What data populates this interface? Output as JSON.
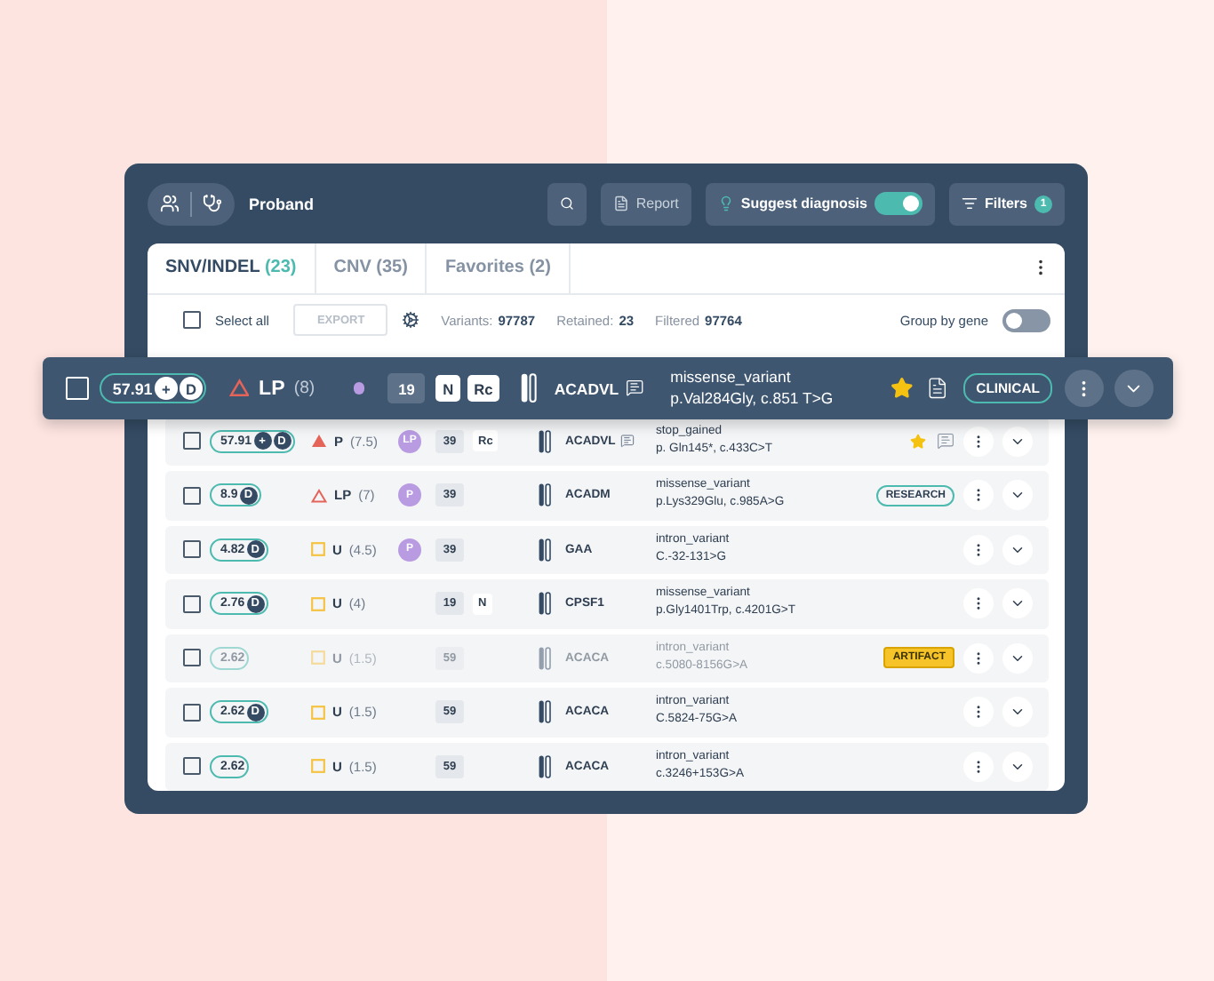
{
  "header": {
    "label": "Proband",
    "report_button": "Report",
    "suggest": {
      "label": "Suggest diagnosis",
      "on": true
    },
    "filters": {
      "label": "Filters",
      "count": "1"
    }
  },
  "tabs": [
    {
      "label": "SNV/INDEL",
      "count": "(23)",
      "selected": true
    },
    {
      "label": "CNV",
      "count": "(35)",
      "selected": false
    },
    {
      "label": "Favorites",
      "count": "(2)",
      "selected": false
    }
  ],
  "toolbar": {
    "select_all": {
      "label": "Select all",
      "checked": false
    },
    "export": {
      "label": "EXPORT",
      "disabled": true
    },
    "stats": [
      {
        "label": "Variants:",
        "value": "97787"
      },
      {
        "label": "Retained:",
        "value": "23"
      },
      {
        "label": "Filtered",
        "value": "97764"
      }
    ],
    "group_by_gene": {
      "label": "Group by gene",
      "on": false
    }
  },
  "highlighted_row": {
    "checked": false,
    "dimmed": false,
    "score": "57.91",
    "plus": "+",
    "d": "D",
    "classification": {
      "kind": "triangle-outline",
      "label": "LP",
      "score": "(8)"
    },
    "acmg": {
      "kind": "dot"
    },
    "chrom": "19",
    "tags": [
      "N",
      "Rc"
    ],
    "gene": "ACADVL",
    "comment": true,
    "consequence": "missense_variant",
    "hgvs": "p.Val284Gly, c.851 T>G",
    "starred": true,
    "comment_note": false,
    "report": true,
    "tag": {
      "kind": "clinical",
      "label": "CLINICAL"
    }
  },
  "rows": [
    {
      "checked": false,
      "dimmed": false,
      "score": "57.91",
      "plus": "+",
      "d": "D",
      "classification": {
        "kind": "triangle-filled",
        "label": "P",
        "score": "(7.5)"
      },
      "acmg": {
        "kind": "badge",
        "label": "LP"
      },
      "chrom": "39",
      "tags": [
        "Rc"
      ],
      "gene": "ACADVL",
      "comment": true,
      "consequence": "stop_gained",
      "hgvs": "p. Gln145*, c.433C>T",
      "starred": true,
      "comment_note": true,
      "report": false
    },
    {
      "checked": false,
      "dimmed": false,
      "score": "8.9",
      "d": "D",
      "classification": {
        "kind": "triangle-outline",
        "label": "LP",
        "score": "(7)"
      },
      "acmg": {
        "kind": "badge",
        "label": "P"
      },
      "chrom": "39",
      "tags": [],
      "gene": "ACADM",
      "comment": false,
      "consequence": "missense_variant",
      "hgvs": "p.Lys329Glu, c.985A>G",
      "starred": false,
      "comment_note": false,
      "report": false,
      "tag": {
        "kind": "research",
        "label": "RESEARCH"
      }
    },
    {
      "checked": false,
      "dimmed": false,
      "score": "4.82",
      "d": "D",
      "classification": {
        "kind": "square",
        "label": "U",
        "score": "(4.5)"
      },
      "acmg": {
        "kind": "badge",
        "label": "P"
      },
      "chrom": "39",
      "tags": [],
      "gene": "GAA",
      "comment": false,
      "consequence": "intron_variant",
      "hgvs": "C.-32-131>G",
      "starred": false,
      "comment_note": false,
      "report": false
    },
    {
      "checked": false,
      "dimmed": false,
      "score": "2.76",
      "d": "D",
      "classification": {
        "kind": "square",
        "label": "U",
        "score": "(4)"
      },
      "chrom": "19",
      "tags": [
        "N"
      ],
      "gene": "CPSF1",
      "comment": false,
      "consequence": "missense_variant",
      "hgvs": "p.Gly1401Trp, c.4201G>T",
      "starred": false,
      "comment_note": false,
      "report": false
    },
    {
      "checked": false,
      "dimmed": true,
      "score": "2.62",
      "classification": {
        "kind": "square",
        "label": "U",
        "score": "(1.5)"
      },
      "chrom": "59",
      "tags": [],
      "gene": "ACACA",
      "comment": false,
      "consequence": "intron_variant",
      "hgvs": "c.5080-8156G>A",
      "starred": false,
      "comment_note": false,
      "report": false,
      "tag": {
        "kind": "artifact",
        "label": "ARTIFACT"
      }
    },
    {
      "checked": false,
      "dimmed": false,
      "score": "2.62",
      "d": "D",
      "classification": {
        "kind": "square",
        "label": "U",
        "score": "(1.5)"
      },
      "chrom": "59",
      "tags": [],
      "gene": "ACACA",
      "comment": false,
      "consequence": "intron_variant",
      "hgvs": "C.5824-75G>A",
      "starred": false,
      "comment_note": false,
      "report": false
    },
    {
      "checked": false,
      "dimmed": false,
      "score": "2.62",
      "classification": {
        "kind": "square",
        "label": "U",
        "score": "(1.5)"
      },
      "chrom": "59",
      "tags": [],
      "gene": "ACACA",
      "comment": false,
      "consequence": "intron_variant",
      "hgvs": "c.3246+153G>A",
      "starred": false,
      "comment_note": false,
      "report": false
    }
  ]
}
